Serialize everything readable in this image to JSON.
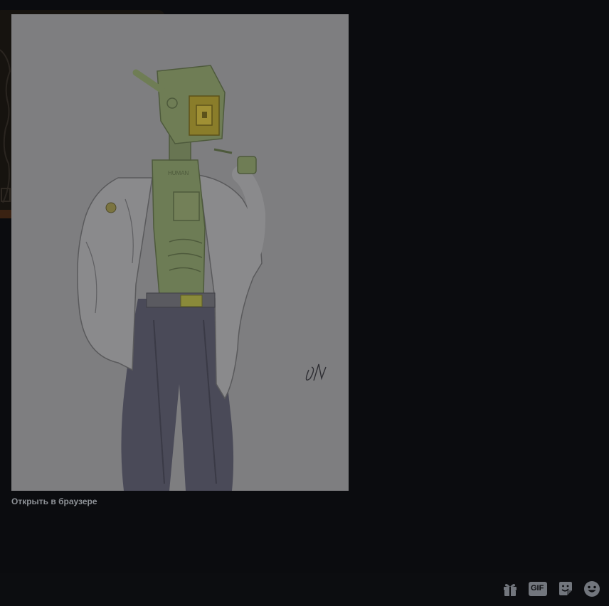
{
  "lightbox": {
    "open_in_browser_label": "Открыть в браузере",
    "image_alt": "sketch-of-robot-in-lab-coat"
  },
  "composer": {
    "buttons": [
      {
        "name": "gift-icon"
      },
      {
        "name": "gif-icon",
        "label": "GIF"
      },
      {
        "name": "sticker-icon"
      },
      {
        "name": "emoji-icon"
      }
    ]
  },
  "colors": {
    "backdrop": "#0b0c0f",
    "link": "#8e9297",
    "icon": "#72767d",
    "image_background": "#7d7d7f"
  }
}
